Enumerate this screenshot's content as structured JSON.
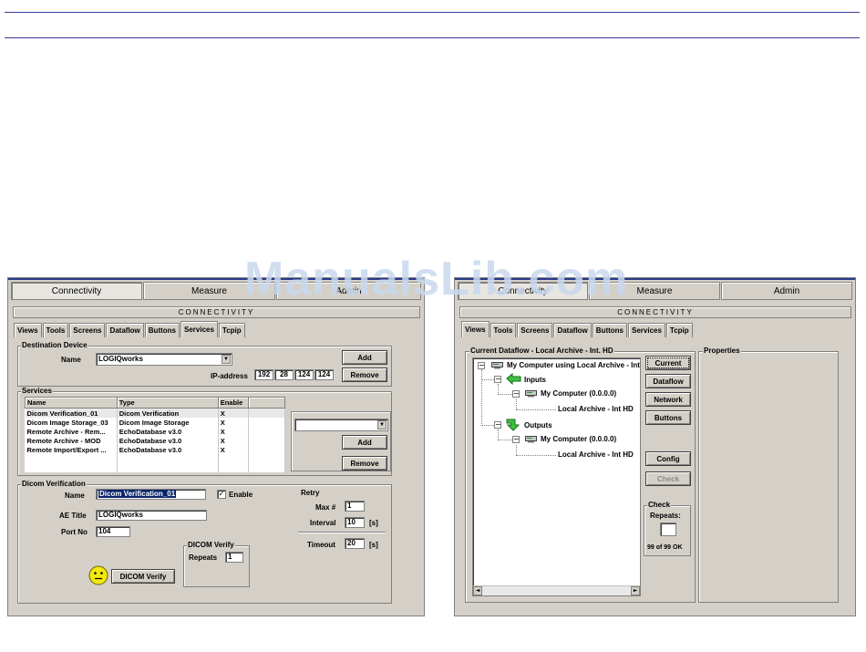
{
  "watermark": "ManualsLib.com",
  "left_window": {
    "main_tabs": [
      "Connectivity",
      "Measure",
      "Admin"
    ],
    "title": "CONNECTIVITY",
    "sub_tabs": [
      "Views",
      "Tools",
      "Screens",
      "Dataflow",
      "Buttons",
      "Services",
      "Tcpip"
    ],
    "destination": {
      "legend": "Destination Device",
      "name_label": "Name",
      "name_value": "LOGIQworks",
      "ip_label": "IP-address",
      "ip": [
        "192",
        "28",
        "124",
        "124"
      ],
      "add_label": "Add",
      "remove_label": "Remove"
    },
    "services": {
      "legend": "Services",
      "columns": [
        "Name",
        "Type",
        "Enable"
      ],
      "rows": [
        [
          "Dicom Verification_01",
          "Dicom Verification",
          "X"
        ],
        [
          "Dicom Image Storage_03",
          "Dicom Image Storage",
          "X"
        ],
        [
          "Remote Archive - Rem...",
          "EchoDatabase v3.0",
          "X"
        ],
        [
          "Remote Archive - MOD",
          "EchoDatabase v3.0",
          "X"
        ],
        [
          "Remote Import/Export ...",
          "EchoDatabase v3.0",
          "X"
        ]
      ],
      "add_label": "Add",
      "remove_label": "Remove"
    },
    "dicom": {
      "legend": "Dicom Verification",
      "name_label": "Name",
      "name_value": "Dicom Verification_01",
      "enable_label": "Enable",
      "enable_checked": "✓",
      "ae_label": "AE Title",
      "ae_value": "LOGIQworks",
      "port_label": "Port No",
      "port_value": "104",
      "retry_legend": "Retry",
      "max_label": "Max #",
      "max_value": "1",
      "interval_label": "Interval",
      "interval_value": "10",
      "interval_unit": "[s]",
      "timeout_label": "Timeout",
      "timeout_value": "20",
      "timeout_unit": "[s]",
      "verify_legend": "DICOM Verify",
      "repeats_label": "Repeats",
      "repeats_value": "1",
      "verify_button": "DICOM Verify"
    }
  },
  "right_window": {
    "main_tabs": [
      "Connectivity",
      "Measure",
      "Admin"
    ],
    "title": "CONNECTIVITY",
    "sub_tabs": [
      "Views",
      "Tools",
      "Screens",
      "Dataflow",
      "Buttons",
      "Services",
      "Tcpip"
    ],
    "dataflow_legend": "Current Dataflow - Local Archive - Int. HD",
    "properties_legend": "Properties",
    "tree": {
      "root": "My Computer using Local Archive - Int",
      "inputs": "Inputs",
      "input_computer": "My Computer (0.0.0.0)",
      "input_archive": "Local Archive - Int HD",
      "outputs": "Outputs",
      "output_computer": "My Computer (0.0.0.0)",
      "output_archive": "Local Archive - Int HD"
    },
    "buttons": {
      "current": "Current",
      "dataflow": "Dataflow",
      "network": "Network",
      "buttons": "Buttons",
      "config": "Config",
      "check": "Check"
    },
    "check_panel": {
      "legend": "Check",
      "repeats_label": "Repeats:",
      "status": "99 of 99 OK"
    }
  }
}
